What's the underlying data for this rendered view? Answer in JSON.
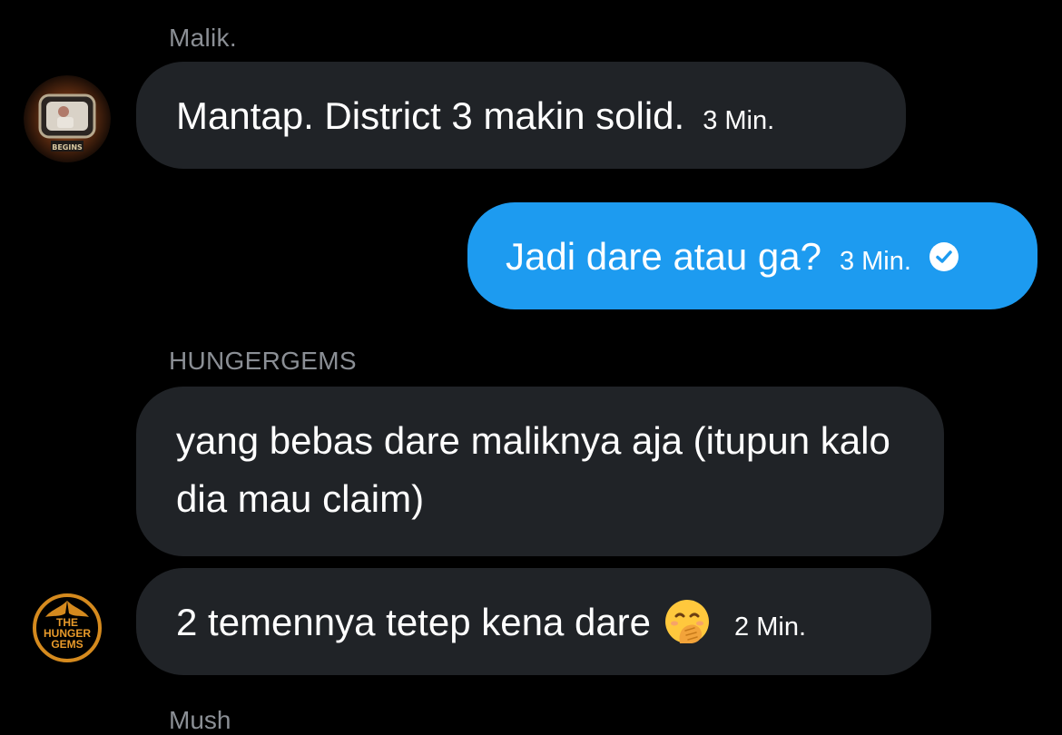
{
  "messages": [
    {
      "sender": "Malik.",
      "text": "Mantap. District 3 makin solid.",
      "time": "3 Min.",
      "avatar_icon": "hunger-games-begins-avatar-icon"
    },
    {
      "text": "Jadi dare atau ga?",
      "time": "3 Min.",
      "status_icon": "check-circle-icon"
    },
    {
      "sender": "HUNGERGEMS",
      "text": "yang bebas dare maliknya aja (itupun kalo dia mau claim)"
    },
    {
      "text": "2 temennya tetep kena dare",
      "emoji": "face-with-hand-over-mouth-icon",
      "time": "2 Min.",
      "avatar_icon": "hunger-gems-mockingjay-avatar-icon",
      "avatar_text": "THE HUNGER GEMS"
    },
    {
      "sender": "Mush"
    }
  ],
  "colors": {
    "background": "#000000",
    "incoming_bubble": "#202327",
    "outgoing_bubble": "#1d9bf0",
    "sender_name": "#8b8f95"
  }
}
